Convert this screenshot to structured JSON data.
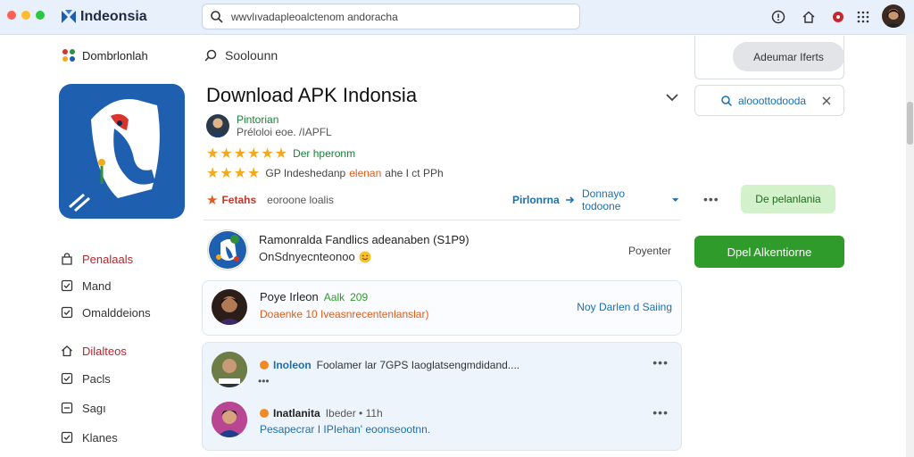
{
  "browser": {
    "brand": "Indeonsia",
    "url_text": "wwvlıvadapleoalctenom andoracha",
    "colors": {
      "close": "#ff5f57",
      "minimize": "#febc2e",
      "maximize": "#28c840"
    }
  },
  "sidebar": {
    "header": "Dombrlonlah",
    "group1": [
      {
        "label": "Penalaals",
        "icon": "bag-icon"
      },
      {
        "label": "Mand",
        "icon": "check-square-icon"
      },
      {
        "label": "Omalddeions",
        "icon": "check-square-icon"
      }
    ],
    "group2": [
      {
        "label": "Dilalteos",
        "icon": "home-icon"
      },
      {
        "label": "Pacls",
        "icon": "check-square-icon"
      },
      {
        "label": "Sagı",
        "icon": "square-minus-icon"
      },
      {
        "label": "Klanes",
        "icon": "check-square-icon"
      }
    ]
  },
  "main": {
    "search_label": "Soolounn",
    "title": "Download APK Indonsia",
    "developer": {
      "name": "Pintorian",
      "subtitle": "Préloloi eoe. /IAPFL"
    },
    "rating1": {
      "stars": 5,
      "text": "Der hperonm"
    },
    "rating2": {
      "stars": 3,
      "prefix": "GP Indeshedanp",
      "highlight": "elenan",
      "suffix": "ahe I ct PPh"
    },
    "tags": {
      "left_bold": "Fetahs",
      "left_rest": "eoroone loalis",
      "link1": "Pirlonrna",
      "link2": "Donnayo todoone"
    },
    "row1": {
      "title": "Ramonralda Fandlics adeanaben (S1P9)",
      "subtitle": "OnSdnyecnteonoo",
      "right": "Poyenter"
    },
    "card1": {
      "name": "Poye Irleon",
      "tag": "Aalk",
      "count": "209",
      "desc": "Doaenke 10 Iveasnrecentenlanslar)",
      "link": "Noy Darlen d Saiing"
    },
    "comments": [
      {
        "name": "Inoleon",
        "text": "Foolamer lar 7GPS Iaoglatsengmdidand....",
        "extra": "•••"
      },
      {
        "name": "Inatlanita",
        "meta": "Ibeder • 11h",
        "text": "Pesapecrar I IPIehan' eoonseootnn."
      }
    ]
  },
  "right": {
    "button1": "Adeumar Iferts",
    "search_text": "alooottodooda",
    "button2": "De pelanlania",
    "button3": "Dpel Alkentiorne"
  }
}
